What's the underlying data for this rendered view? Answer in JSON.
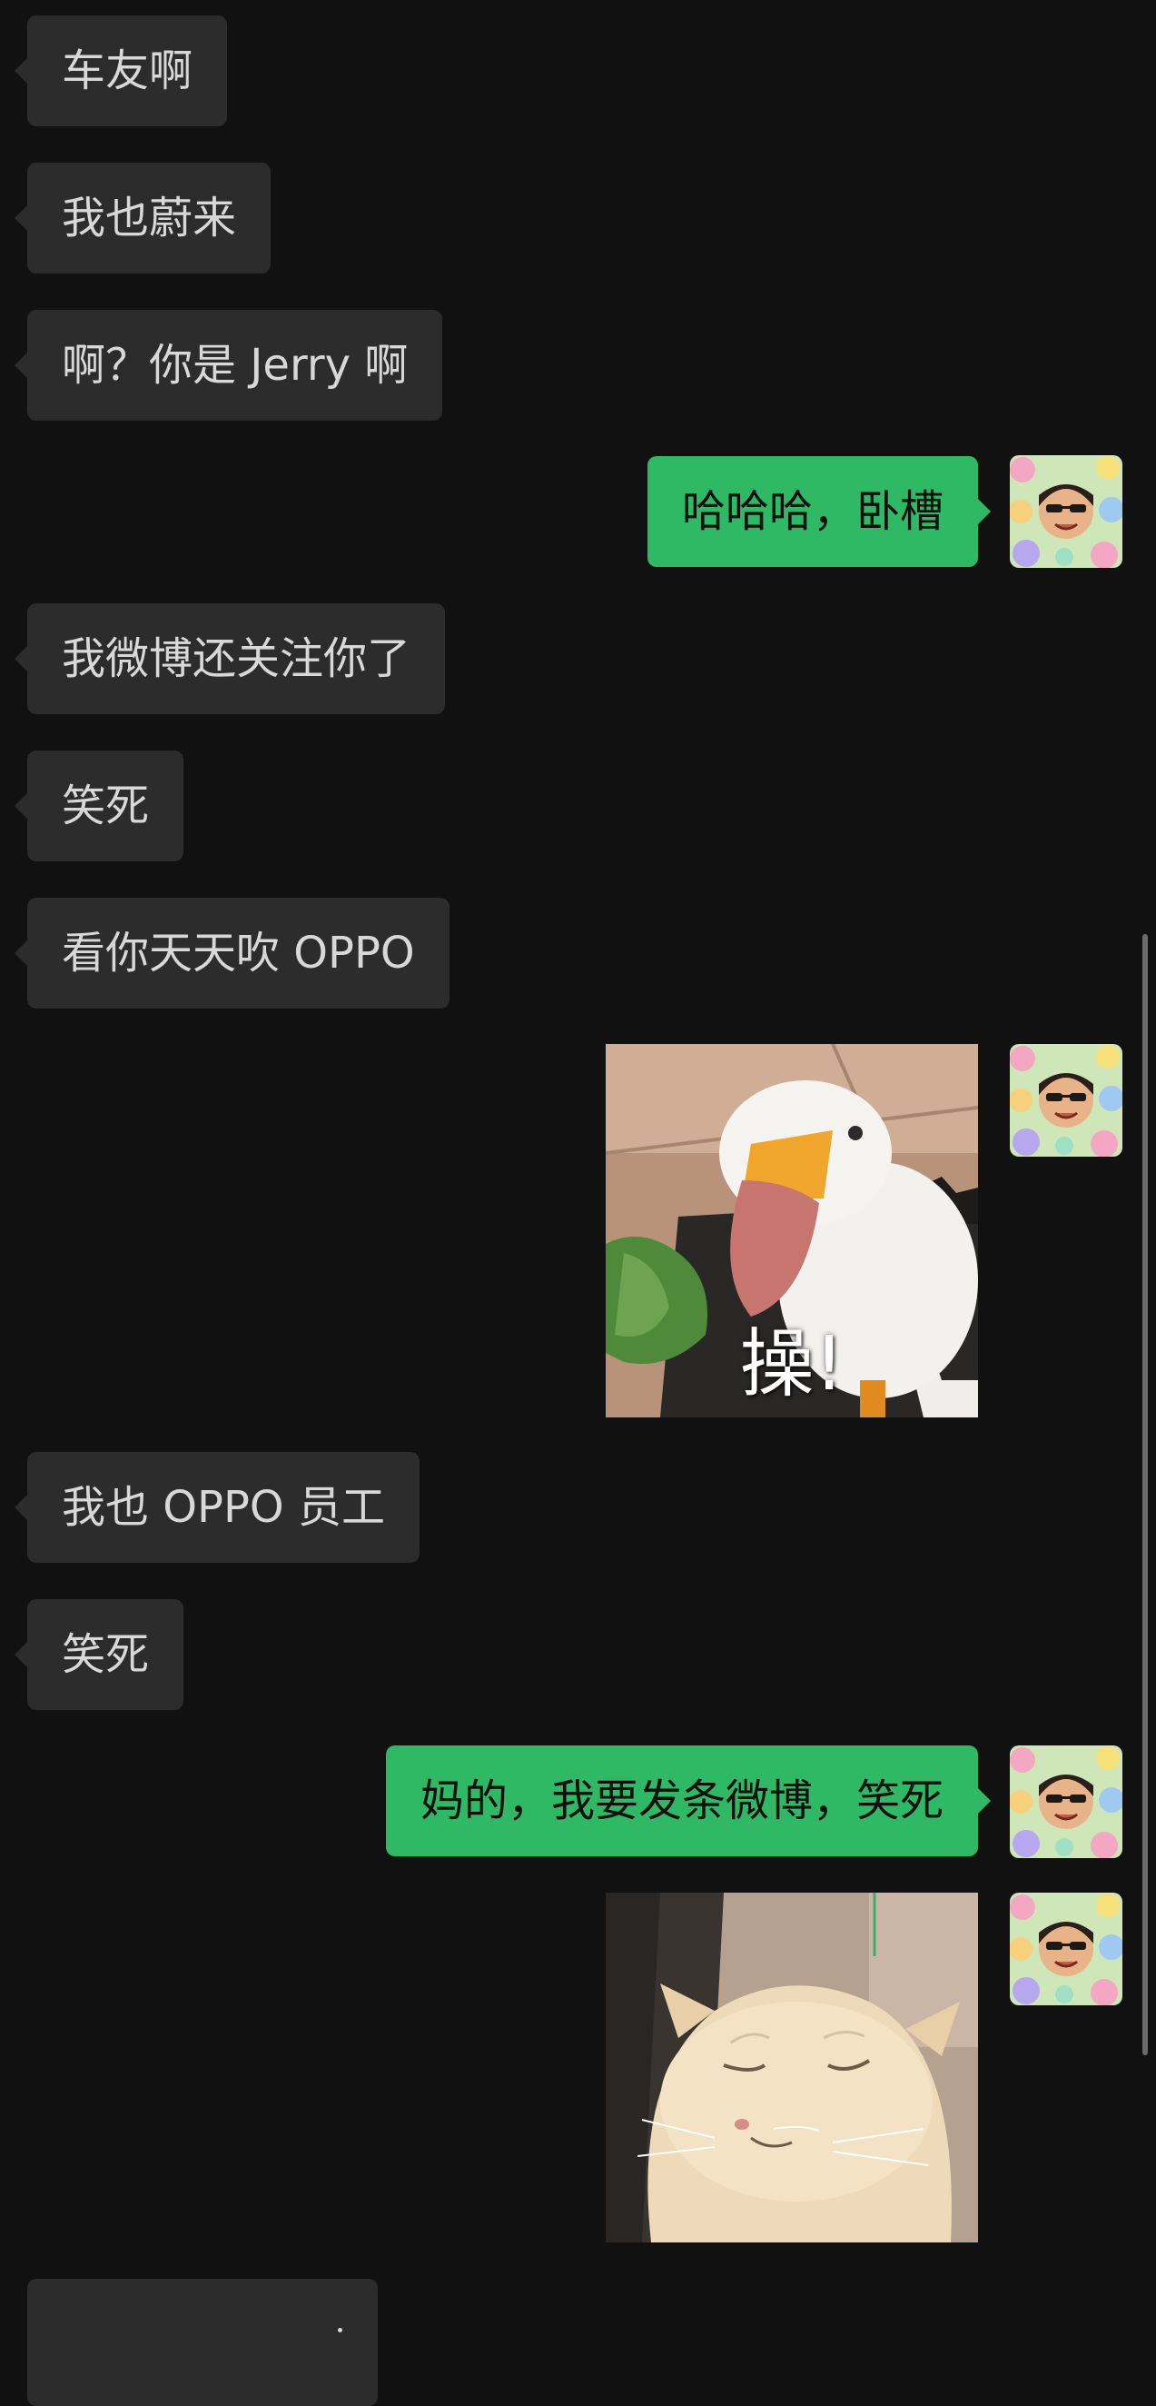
{
  "messages": [
    {
      "side": "left",
      "text": "车友啊"
    },
    {
      "side": "left",
      "text": "我也蔚来"
    },
    {
      "side": "left",
      "text": "啊？你是 Jerry 啊"
    },
    {
      "side": "right",
      "text": "哈哈哈，卧槽"
    },
    {
      "side": "left",
      "text": "我微博还关注你了"
    },
    {
      "side": "left",
      "text": "笑死"
    },
    {
      "side": "left",
      "text": "看你天天吹 OPPO"
    },
    {
      "side": "right",
      "type": "sticker",
      "sticker": "duck-yelling-sticker",
      "caption": "操!"
    },
    {
      "side": "left",
      "text": "我也 OPPO 员工"
    },
    {
      "side": "left",
      "text": "笑死"
    },
    {
      "side": "right",
      "text": "妈的，我要发条微博，笑死"
    },
    {
      "side": "right",
      "type": "sticker",
      "sticker": "squinting-cat-sticker"
    }
  ],
  "colors": {
    "background": "#111111",
    "incoming_bubble": "#2c2c2c",
    "outgoing_bubble": "#2fb965",
    "incoming_text": "#d8d8d8",
    "outgoing_text": "#101010"
  }
}
